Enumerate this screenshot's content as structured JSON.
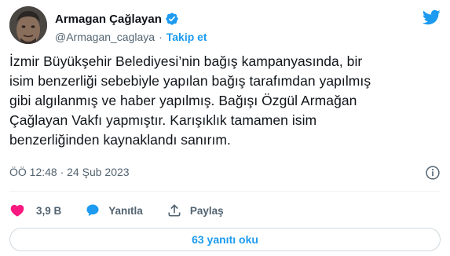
{
  "tweet": {
    "author": {
      "display_name": "Armagan Çağlayan",
      "handle": "@Armagan_caglaya",
      "separator": "·",
      "follow_label": "Takip et",
      "verified": true
    },
    "text_lines": [
      "İzmir Büyükşehir Belediyesi’nin bağış kampanyasında, bir",
      "isim benzerliği sebebiyle yapılan bağış tarafımdan yapılmış",
      "gibi algılanmış ve haber yapılmış. Bağışı Özgül Armağan",
      "Çağlayan Vakfı yapmıştır. Karışıklık tamamen isim",
      "benzerliğinden kaynaklandı sanırım."
    ],
    "timestamp": "ÖÖ 12:48 · 24 Şub 2023",
    "actions": {
      "like_count": "3,9 B",
      "reply_label": "Yanıtla",
      "share_label": "Paylaş"
    },
    "read_replies_label": "63 yanıtı oku"
  },
  "colors": {
    "accent": "#1d9bf0",
    "like": "#f91880",
    "muted": "#536471",
    "text": "#0f1419"
  },
  "icons": [
    "verified-badge-icon",
    "twitter-bird-icon",
    "info-icon",
    "heart-icon",
    "reply-bubble-icon",
    "share-icon"
  ]
}
